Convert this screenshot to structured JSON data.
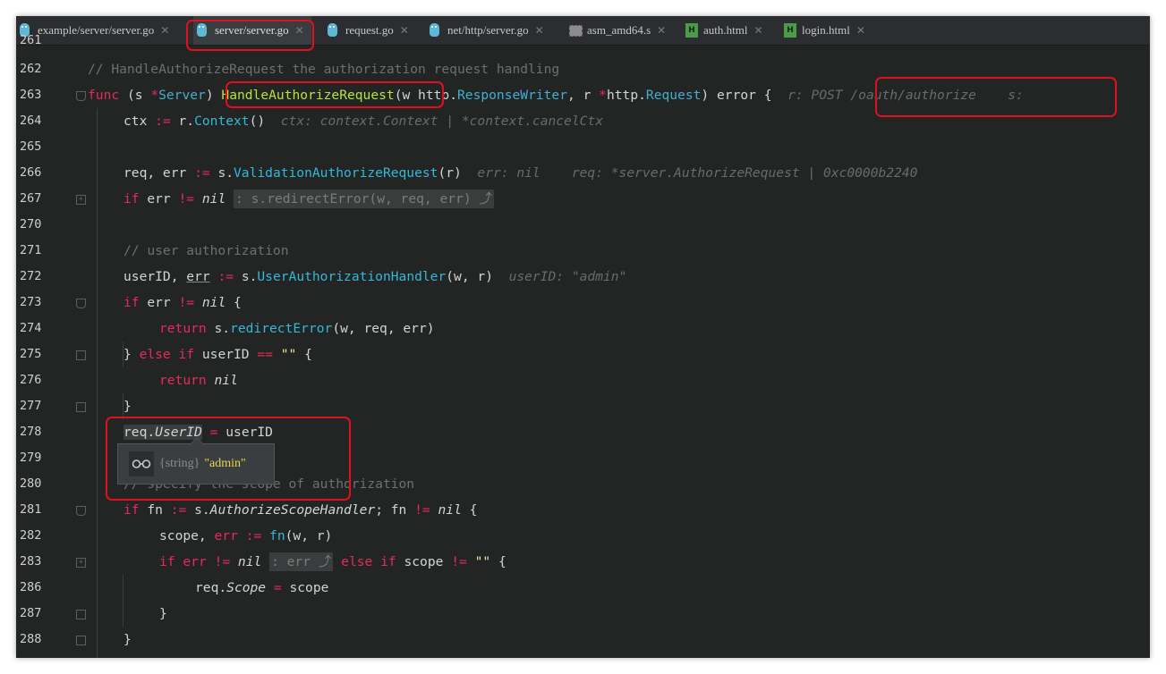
{
  "tabs": [
    {
      "label": "example/server/server.go",
      "icon": "gopher-icon",
      "active": false
    },
    {
      "label": "server/server.go",
      "icon": "gopher-icon",
      "active": true
    },
    {
      "label": "request.go",
      "icon": "gopher-icon",
      "active": false
    },
    {
      "label": "net/http/server.go",
      "icon": "gopher-icon",
      "active": false
    },
    {
      "label": "asm_amd64.s",
      "icon": "asm-file-icon",
      "active": false
    },
    {
      "label": "auth.html",
      "icon": "html-file-icon",
      "active": false
    },
    {
      "label": "login.html",
      "icon": "html-file-icon",
      "active": false
    }
  ],
  "close_glyph": "✕",
  "line_numbers": [
    "261",
    "262",
    "263",
    "264",
    "265",
    "266",
    "267",
    "270",
    "271",
    "272",
    "273",
    "274",
    "275",
    "276",
    "277",
    "278",
    "279",
    "280",
    "281",
    "282",
    "283",
    "286",
    "287",
    "288"
  ],
  "code": {
    "l262": {
      "comment": "// HandleAuthorizeRequest the authorization request handling"
    },
    "l263": {
      "kw_func": "func",
      "p1": " (s ",
      "star": "*",
      "type": "Server",
      "p2": ") ",
      "fn": "HandleAuthorizeRequest",
      "p3": "(w http.",
      "t2": "ResponseWriter",
      "p4": ", r ",
      "star2": "*",
      "p5": "http.",
      "t3": "Request",
      "p6": ") error {  ",
      "hint": "r: POST /oauth/authorize    s:"
    },
    "l264": {
      "p1": "ctx ",
      "op": ":=",
      "p2": " r.",
      "fn": "Context",
      "p3": "()  ",
      "hint": "ctx: context.Context | *context.cancelCtx"
    },
    "l266": {
      "p1": "req, err ",
      "op": ":=",
      "p2": " s.",
      "fn": "ValidationAuthorizeRequest",
      "p3": "(r)  ",
      "hint": "err: nil    req: *server.AuthorizeRequest | 0xc0000b2240"
    },
    "l267": {
      "kw": "if",
      "p1": " err ",
      "op": "!=",
      "sp": " ",
      "nil": "nil",
      "collapsed": ": s.redirectError(w, req, err) ⤴"
    },
    "l271": {
      "comment": "// user authorization"
    },
    "l272": {
      "p1": "userID, ",
      "err": "err",
      "sp": " ",
      "op": ":=",
      "p2": " s.",
      "fn": "UserAuthorizationHandler",
      "p3": "(w, r)  ",
      "hint": "userID: \"admin\""
    },
    "l273": {
      "kw": "if",
      "p1": " err ",
      "op": "!=",
      "sp": " ",
      "nil": "nil",
      "p2": " {"
    },
    "l274": {
      "kw": "return",
      "p1": " s.",
      "fn": "redirectError",
      "p2": "(w, req, err)"
    },
    "l275": {
      "p1": "} ",
      "kw": "else if",
      "p2": " userID ",
      "op": "==",
      "sp": " ",
      "str": "\"\"",
      "p3": " {"
    },
    "l276": {
      "kw": "return",
      "sp": " ",
      "nil": "nil"
    },
    "l277": {
      "p1": "}"
    },
    "l278": {
      "p1": "req.",
      "field": "UserID",
      "sp": " ",
      "op": "=",
      "p2": " userID"
    },
    "l280": {
      "comment": "// specify the scope of authorization"
    },
    "l281": {
      "kw": "if",
      "p1": " fn ",
      "op": ":=",
      "p2": " s.",
      "field": "AuthorizeScopeHandler",
      "p3": "; fn ",
      "op2": "!=",
      "sp": " ",
      "nil": "nil",
      "p4": " {"
    },
    "l282": {
      "p1": "scope, ",
      "err": "err",
      "sp": " ",
      "op": ":=",
      "sp2": " ",
      "fn": "fn",
      "p2": "(w, r)"
    },
    "l283": {
      "kw": "if",
      "sp": " ",
      "err": "err",
      "sp2": " ",
      "op": "!=",
      "sp3": " ",
      "nil": "nil",
      "sp4": " ",
      "collapsed": ": err ⤴",
      "sp5": " ",
      "kw2": "else if",
      "p1": " scope ",
      "op2": "!=",
      "sp6": " ",
      "str": "\"\"",
      "p2": " {"
    },
    "l286": {
      "p1": "req.",
      "field": "Scope",
      "sp": " ",
      "op": "=",
      "p2": " scope"
    },
    "l287": {
      "p1": "}"
    },
    "l288": {
      "p1": "}"
    }
  },
  "tooltip": {
    "type": "{string}",
    "value": "\"admin\""
  },
  "colors": {
    "background": "#232525",
    "keyword": "#e8295c",
    "type": "#3fb0d0",
    "function_name": "#b6e33c",
    "annotation_box": "#e0101e"
  }
}
